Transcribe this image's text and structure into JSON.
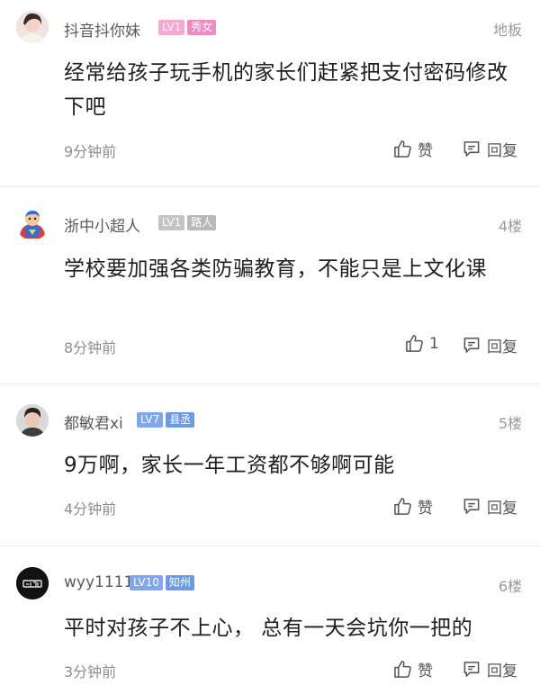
{
  "colors": {
    "badge_lv_pink": "#f5a8d2",
    "badge_title_pink": "#f28ac2",
    "badge_lv_gray": "#c4c4c4",
    "badge_title_gray": "#b9b9b9",
    "badge_lv_blue": "#7fa6ef",
    "badge_title_blue": "#6c9ae8"
  },
  "comments": [
    {
      "username": "抖音抖你妹",
      "level": "LV1",
      "title": "秀女",
      "floor": "地板",
      "text": "经常给孩子玩手机的家长们赶紧把支付密码修改下吧",
      "time": "9分钟前",
      "like_label": "赞",
      "reply_label": "回复"
    },
    {
      "username": "浙中小超人",
      "level": "LV1",
      "title": "路人",
      "floor": "4楼",
      "text": "学校要加强各类防骗教育，不能只是上文化课",
      "time": "8分钟前",
      "like_label": "1",
      "reply_label": "回复"
    },
    {
      "username": "都敏君xi",
      "level": "LV7",
      "title": "县丞",
      "floor": "5楼",
      "text": "9万啊，家长一年工资都不够啊可能",
      "time": "4分钟前",
      "like_label": "赞",
      "reply_label": "回复"
    },
    {
      "username": "wyy1111",
      "level": "LV10",
      "title": "知州",
      "floor": "6楼",
      "text": "平时对孩子不上心，  总有一天会坑你一把的",
      "time": "3分钟前",
      "like_label": "赞",
      "reply_label": "回复"
    }
  ]
}
